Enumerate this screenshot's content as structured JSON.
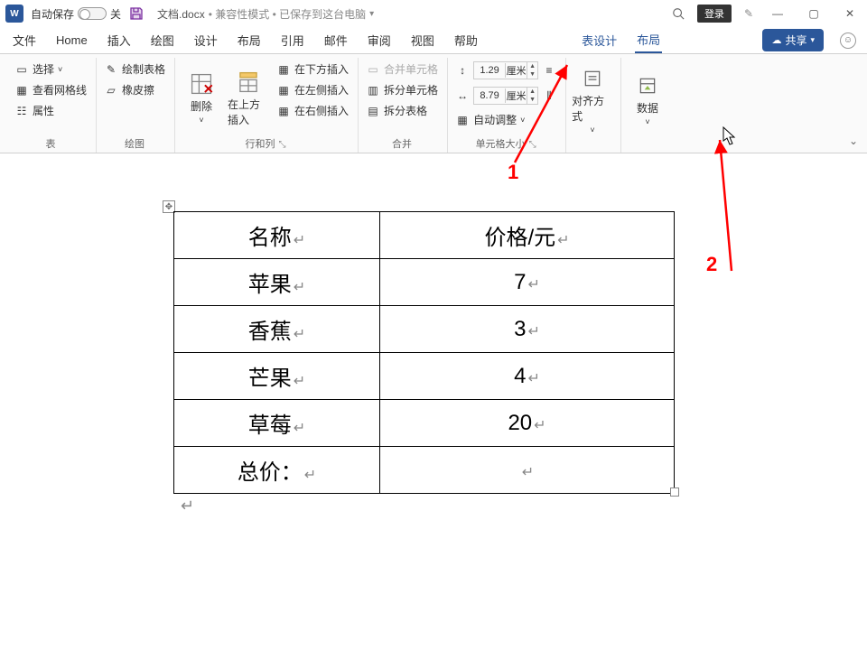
{
  "title": {
    "autosave": "自动保存",
    "autosave_state": "关",
    "doc": "文档.docx",
    "compat": "• 兼容性模式 • 已保存到这台电脑",
    "login": "登录"
  },
  "menu": {
    "file": "文件",
    "home": "Home",
    "insert": "插入",
    "draw": "绘图",
    "design": "设计",
    "layout": "布局",
    "ref": "引用",
    "mail": "邮件",
    "review": "审阅",
    "view": "视图",
    "help": "帮助",
    "table_design": "表设计",
    "table_layout": "布局",
    "share": "共享"
  },
  "ribbon": {
    "table_group": "表",
    "select": "选择",
    "gridlines": "查看网格线",
    "properties": "属性",
    "draw_group": "绘图",
    "draw_table": "绘制表格",
    "eraser": "橡皮擦",
    "rowcol_group": "行和列",
    "delete": "删除",
    "insert_above": "在上方插入",
    "insert_below": "在下方插入",
    "insert_left": "在左侧插入",
    "insert_right": "在右侧插入",
    "merge_group": "合并",
    "merge": "合并单元格",
    "split_cells": "拆分单元格",
    "split_table": "拆分表格",
    "size_group": "单元格大小",
    "height": "1.29",
    "width": "8.79",
    "unit": "厘米",
    "autofit": "自动调整",
    "align_group": "对齐方式",
    "data_group": "数据"
  },
  "annotations": {
    "a1": "1",
    "a2": "2"
  },
  "table": {
    "rows": [
      {
        "c1": "名称",
        "c2": "价格/元"
      },
      {
        "c1": "苹果",
        "c2": "7"
      },
      {
        "c1": "香蕉",
        "c2": "3"
      },
      {
        "c1": "芒果",
        "c2": "4"
      },
      {
        "c1": "草莓",
        "c2": "20"
      },
      {
        "c1": "总价：",
        "c2": ""
      }
    ]
  }
}
